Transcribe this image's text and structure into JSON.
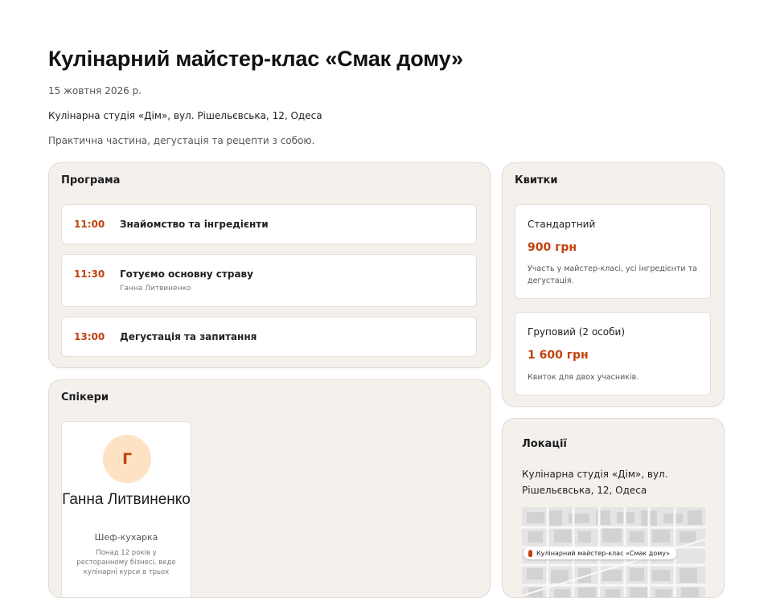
{
  "event": {
    "title": "Кулінарний майстер-клас «Смак дому»",
    "date": "15 жовтня 2026 р.",
    "venue": "Кулінарна студія «Дім», вул. Рішельєвська, 12, Одеса",
    "description": "Практична частина, дегустація та рецепти з собою."
  },
  "program": {
    "title": "Програма",
    "items": [
      {
        "time": "11:00",
        "name": "Знайомство та інгредієнти",
        "speaker": ""
      },
      {
        "time": "11:30",
        "name": "Готуємо основну страву",
        "speaker": "Ганна Литвиненко"
      },
      {
        "time": "13:00",
        "name": "Дегустація та запитання",
        "speaker": ""
      }
    ]
  },
  "speakers": {
    "title": "Спікери",
    "items": [
      {
        "initial": "Г",
        "name": "Ганна Литвиненко",
        "role": "Шеф-кухарка",
        "bio": "Понад 12 років у ресторанному бізнесі, веде кулінарні курси в трьох"
      }
    ]
  },
  "tickets": {
    "title": "Квитки",
    "items": [
      {
        "name": "Стандартний",
        "price": "900 грн",
        "description": "Участь у майстер-класі, усі інгредієнти та дегустація."
      },
      {
        "name": "Груповий (2 особи)",
        "price": "1 600 грн",
        "description": "Квиток для двох учасників."
      }
    ]
  },
  "locations": {
    "title": "Локації",
    "address": "Кулінарна студія «Дім», вул. Рішельєвська, 12, Одеса",
    "map_label": "Кулінарний майстер-клас «Смак дому»"
  },
  "colors": {
    "accent": "#c2410c",
    "panel_bg": "#f4f0ec",
    "avatar_bg": "#fde3c4"
  }
}
